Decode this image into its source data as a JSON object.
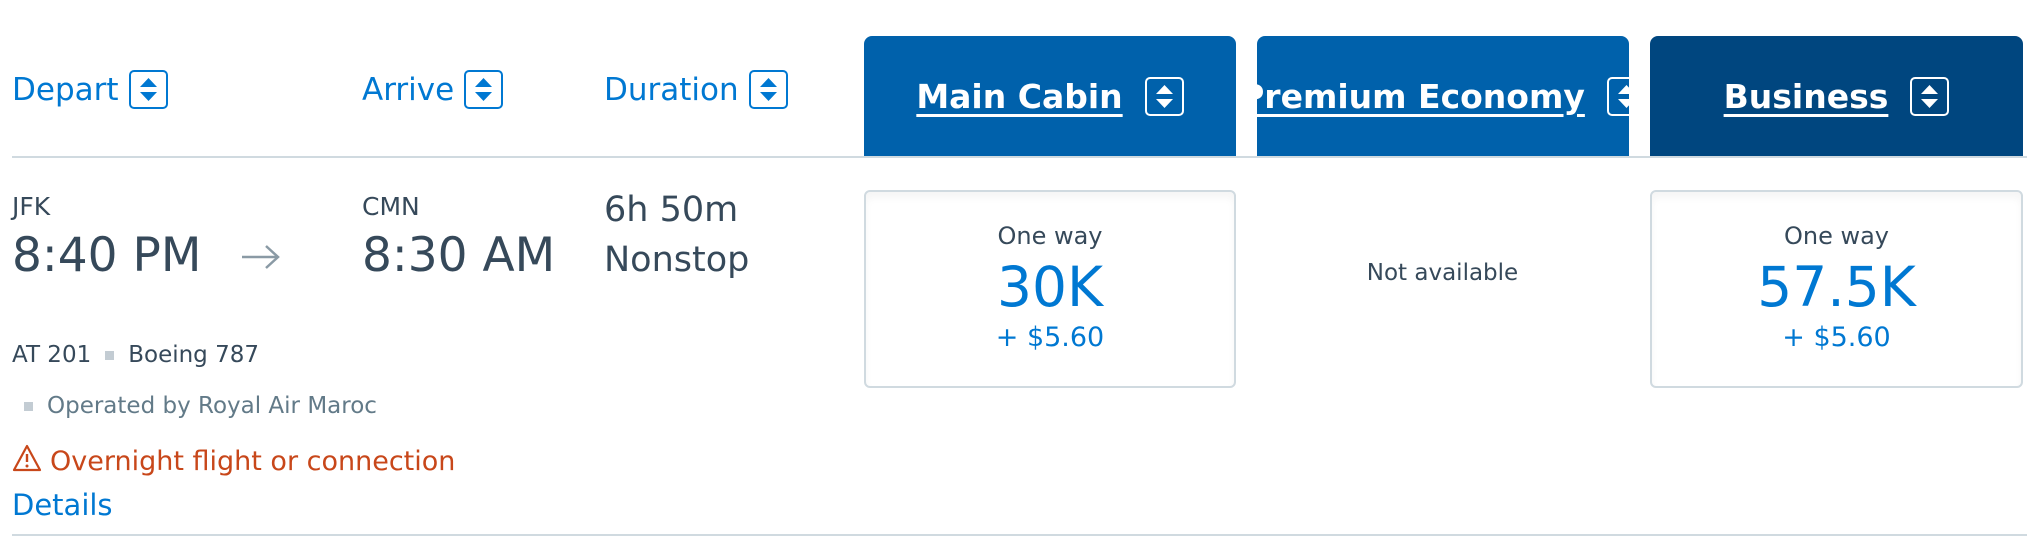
{
  "columns": {
    "depart": "Depart",
    "arrive": "Arrive",
    "duration": "Duration"
  },
  "cabins": {
    "main": "Main Cabin",
    "premium": "Premium Economy",
    "business": "Business"
  },
  "flight": {
    "origin_code": "JFK",
    "depart_time": "8:40 PM",
    "dest_code": "CMN",
    "arrive_time": "8:30 AM",
    "duration": "6h 50m",
    "stops": "Nonstop",
    "flight_number": "AT 201",
    "aircraft": "Boeing 787",
    "operated_by": "Operated by Royal Air Maroc",
    "warning": "Overnight flight or connection",
    "details_link": "Details"
  },
  "fares": {
    "main": {
      "label": "One way",
      "miles": "30K",
      "fee": "+ $5.60"
    },
    "premium": {
      "status": "Not available"
    },
    "business": {
      "label": "One way",
      "miles": "57.5K",
      "fee": "+ $5.60"
    }
  },
  "colors": {
    "link_blue": "#0078d2",
    "header_blue": "#0061ab",
    "business_blue": "#00467f",
    "warning_orange": "#c8471a"
  },
  "icons": {
    "sort": "sort-updown-icon",
    "arrow": "right-arrow-icon",
    "warning": "warning-triangle-icon"
  }
}
